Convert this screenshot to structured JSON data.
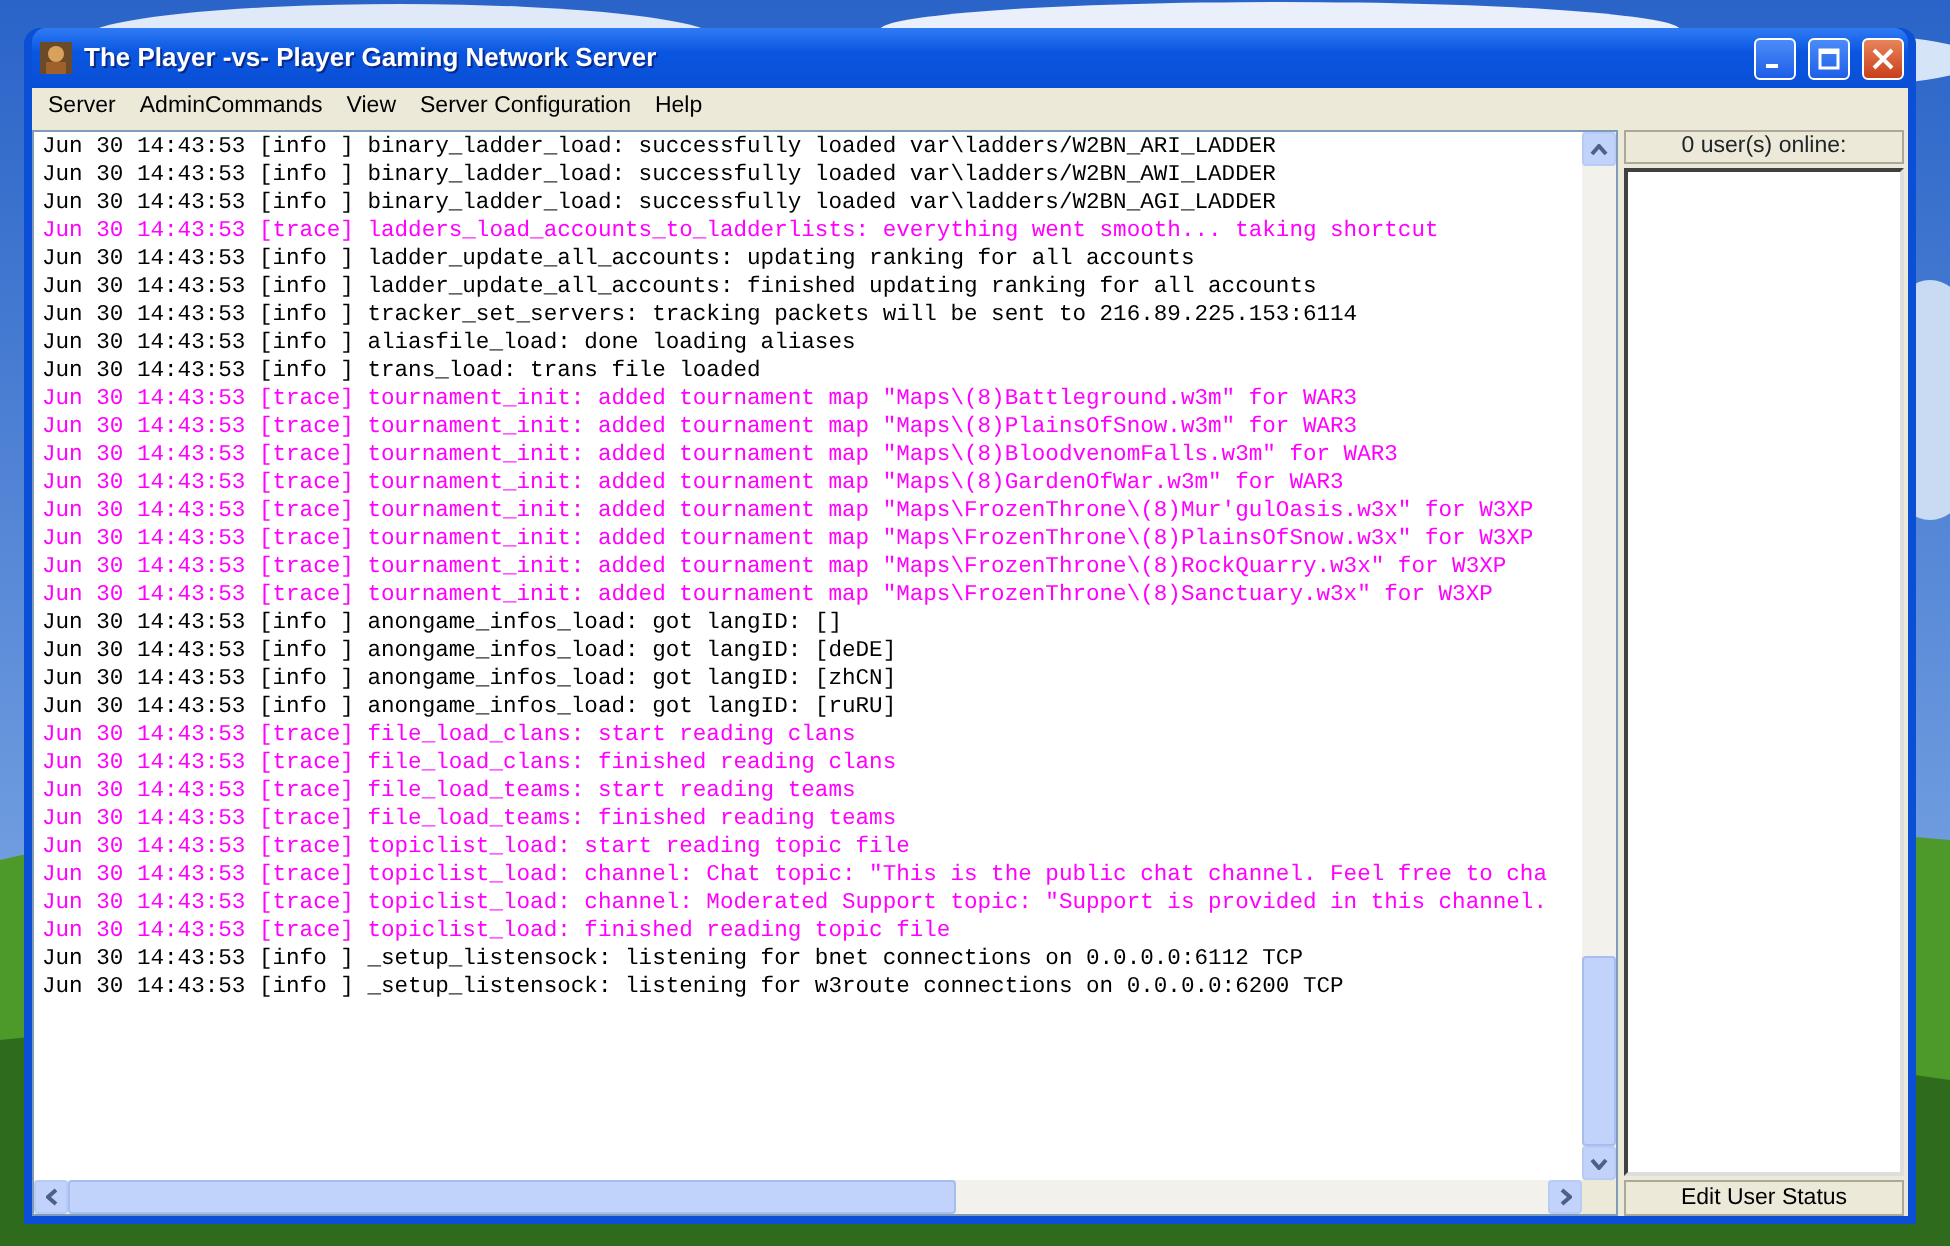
{
  "window": {
    "title": "The Player -vs- Player Gaming Network Server"
  },
  "menu": [
    "Server",
    "AdminCommands",
    "View",
    "Server Configuration",
    "Help"
  ],
  "log": [
    {
      "kind": "info",
      "text": "Jun 30 14:43:53 [info ] binary_ladder_load: successfully loaded var\\ladders/W2BN_ARI_LADDER"
    },
    {
      "kind": "info",
      "text": "Jun 30 14:43:53 [info ] binary_ladder_load: successfully loaded var\\ladders/W2BN_AWI_LADDER"
    },
    {
      "kind": "info",
      "text": "Jun 30 14:43:53 [info ] binary_ladder_load: successfully loaded var\\ladders/W2BN_AGI_LADDER"
    },
    {
      "kind": "trace",
      "text": "Jun 30 14:43:53 [trace] ladders_load_accounts_to_ladderlists: everything went smooth... taking shortcut"
    },
    {
      "kind": "info",
      "text": "Jun 30 14:43:53 [info ] ladder_update_all_accounts: updating ranking for all accounts"
    },
    {
      "kind": "info",
      "text": "Jun 30 14:43:53 [info ] ladder_update_all_accounts: finished updating ranking for all accounts"
    },
    {
      "kind": "info",
      "text": "Jun 30 14:43:53 [info ] tracker_set_servers: tracking packets will be sent to 216.89.225.153:6114"
    },
    {
      "kind": "info",
      "text": "Jun 30 14:43:53 [info ] aliasfile_load: done loading aliases"
    },
    {
      "kind": "info",
      "text": "Jun 30 14:43:53 [info ] trans_load: trans file loaded"
    },
    {
      "kind": "trace",
      "text": "Jun 30 14:43:53 [trace] tournament_init: added tournament map \"Maps\\(8)Battleground.w3m\" for WAR3"
    },
    {
      "kind": "trace",
      "text": "Jun 30 14:43:53 [trace] tournament_init: added tournament map \"Maps\\(8)PlainsOfSnow.w3m\" for WAR3"
    },
    {
      "kind": "trace",
      "text": "Jun 30 14:43:53 [trace] tournament_init: added tournament map \"Maps\\(8)BloodvenomFalls.w3m\" for WAR3"
    },
    {
      "kind": "trace",
      "text": "Jun 30 14:43:53 [trace] tournament_init: added tournament map \"Maps\\(8)GardenOfWar.w3m\" for WAR3"
    },
    {
      "kind": "trace",
      "text": "Jun 30 14:43:53 [trace] tournament_init: added tournament map \"Maps\\FrozenThrone\\(8)Mur'gulOasis.w3x\" for W3XP"
    },
    {
      "kind": "trace",
      "text": "Jun 30 14:43:53 [trace] tournament_init: added tournament map \"Maps\\FrozenThrone\\(8)PlainsOfSnow.w3x\" for W3XP"
    },
    {
      "kind": "trace",
      "text": "Jun 30 14:43:53 [trace] tournament_init: added tournament map \"Maps\\FrozenThrone\\(8)RockQuarry.w3x\" for W3XP"
    },
    {
      "kind": "trace",
      "text": "Jun 30 14:43:53 [trace] tournament_init: added tournament map \"Maps\\FrozenThrone\\(8)Sanctuary.w3x\" for W3XP"
    },
    {
      "kind": "info",
      "text": "Jun 30 14:43:53 [info ] anongame_infos_load: got langID: []"
    },
    {
      "kind": "info",
      "text": "Jun 30 14:43:53 [info ] anongame_infos_load: got langID: [deDE]"
    },
    {
      "kind": "info",
      "text": "Jun 30 14:43:53 [info ] anongame_infos_load: got langID: [zhCN]"
    },
    {
      "kind": "info",
      "text": "Jun 30 14:43:53 [info ] anongame_infos_load: got langID: [ruRU]"
    },
    {
      "kind": "trace",
      "text": "Jun 30 14:43:53 [trace] file_load_clans: start reading clans"
    },
    {
      "kind": "trace",
      "text": "Jun 30 14:43:53 [trace] file_load_clans: finished reading clans"
    },
    {
      "kind": "trace",
      "text": "Jun 30 14:43:53 [trace] file_load_teams: start reading teams"
    },
    {
      "kind": "trace",
      "text": "Jun 30 14:43:53 [trace] file_load_teams: finished reading teams"
    },
    {
      "kind": "trace",
      "text": "Jun 30 14:43:53 [trace] topiclist_load: start reading topic file"
    },
    {
      "kind": "trace",
      "text": "Jun 30 14:43:53 [trace] topiclist_load: channel: Chat topic: \"This is the public chat channel. Feel free to cha"
    },
    {
      "kind": "trace",
      "text": "Jun 30 14:43:53 [trace] topiclist_load: channel: Moderated Support topic: \"Support is provided in this channel."
    },
    {
      "kind": "trace",
      "text": "Jun 30 14:43:53 [trace] topiclist_load: finished reading topic file"
    },
    {
      "kind": "info",
      "text": "Jun 30 14:43:53 [info ] _setup_listensock: listening for bnet connections on 0.0.0.0:6112 TCP"
    },
    {
      "kind": "info",
      "text": "Jun 30 14:43:53 [info ] _setup_listensock: listening for w3route connections on 0.0.0.0:6200 TCP"
    }
  ],
  "users": {
    "header": "0 user(s) online:",
    "button": "Edit User Status"
  }
}
